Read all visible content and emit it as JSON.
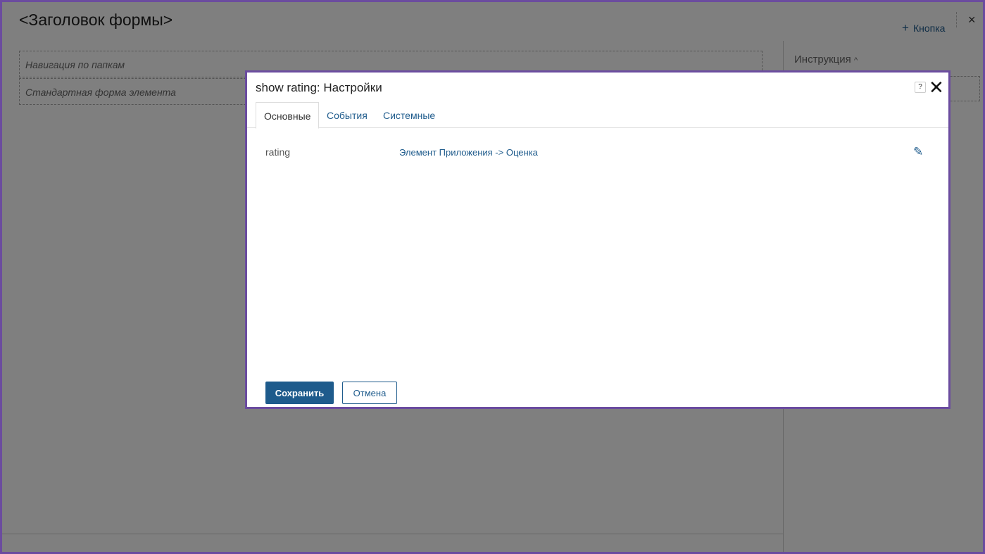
{
  "page": {
    "title": "<Заголовок формы>",
    "add_button": "Кнопка",
    "nav_placeholder": "Навигация по папкам",
    "form_placeholder": "Стандартная форма элемента",
    "instruction": "Инструкция",
    "close": "×"
  },
  "modal": {
    "title": "show rating: Настройки",
    "help": "?",
    "close": "✕",
    "tabs": [
      {
        "label": "Основные"
      },
      {
        "label": "События"
      },
      {
        "label": "Системные"
      }
    ],
    "field_label": "rating",
    "field_value": "Элемент Приложения -> Оценка",
    "save": "Сохранить",
    "cancel": "Отмена"
  }
}
